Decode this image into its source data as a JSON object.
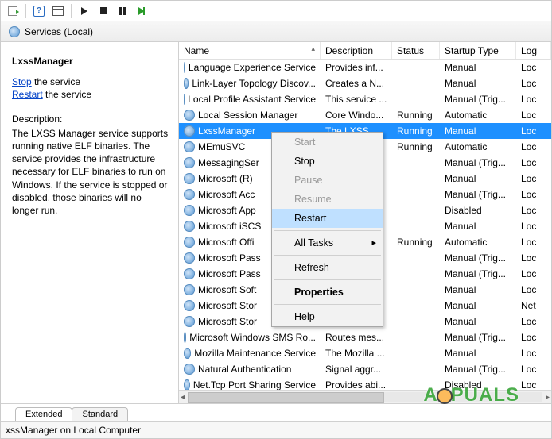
{
  "header": {
    "title": "Services (Local)"
  },
  "details": {
    "title": "LxssManager",
    "stop_label": "Stop",
    "stop_suffix": " the service",
    "restart_label": "Restart",
    "restart_suffix": " the service",
    "description_label": "Description:",
    "description_body": "The LXSS Manager service supports running native ELF binaries. The service provides the infrastructure necessary for ELF binaries to run on Windows. If the service is stopped or disabled, those binaries will no longer run."
  },
  "columns": {
    "name": "Name",
    "description": "Description",
    "status": "Status",
    "startup": "Startup Type",
    "logon": "Log"
  },
  "rows": [
    {
      "name": "Language Experience Service",
      "desc": "Provides inf...",
      "status": "",
      "startup": "Manual",
      "logon": "Loc"
    },
    {
      "name": "Link-Layer Topology Discov...",
      "desc": "Creates a N...",
      "status": "",
      "startup": "Manual",
      "logon": "Loc"
    },
    {
      "name": "Local Profile Assistant Service",
      "desc": "This service ...",
      "status": "",
      "startup": "Manual (Trig...",
      "logon": "Loc"
    },
    {
      "name": "Local Session Manager",
      "desc": "Core Windo...",
      "status": "Running",
      "startup": "Automatic",
      "logon": "Loc"
    },
    {
      "name": "LxssManager",
      "desc": "The LXSS M...",
      "status": "Running",
      "startup": "Manual",
      "logon": "Loc",
      "selected": true
    },
    {
      "name": "MEmuSVC",
      "desc": "",
      "status": "Running",
      "startup": "Automatic",
      "logon": "Loc"
    },
    {
      "name": "MessagingSer",
      "desc": "",
      "status": "",
      "startup": "Manual (Trig...",
      "logon": "Loc"
    },
    {
      "name": "Microsoft (R)",
      "desc": "",
      "status": "",
      "startup": "Manual",
      "logon": "Loc"
    },
    {
      "name": "Microsoft Acc",
      "desc": "",
      "status": "",
      "startup": "Manual (Trig...",
      "logon": "Loc"
    },
    {
      "name": "Microsoft App",
      "desc": "",
      "status": "",
      "startup": "Disabled",
      "logon": "Loc"
    },
    {
      "name": "Microsoft iSCS",
      "desc": "",
      "status": "",
      "startup": "Manual",
      "logon": "Loc"
    },
    {
      "name": "Microsoft Offi",
      "desc": "",
      "status": "Running",
      "startup": "Automatic",
      "logon": "Loc"
    },
    {
      "name": "Microsoft Pass",
      "desc": "",
      "status": "",
      "startup": "Manual (Trig...",
      "logon": "Loc"
    },
    {
      "name": "Microsoft Pass",
      "desc": "",
      "status": "",
      "startup": "Manual (Trig...",
      "logon": "Loc"
    },
    {
      "name": "Microsoft Soft",
      "desc": "",
      "status": "",
      "startup": "Manual",
      "logon": "Loc"
    },
    {
      "name": "Microsoft Stor",
      "desc": "",
      "status": "",
      "startup": "Manual",
      "logon": "Net"
    },
    {
      "name": "Microsoft Stor",
      "desc": "",
      "status": "",
      "startup": "Manual",
      "logon": "Loc"
    },
    {
      "name": "Microsoft Windows SMS Ro...",
      "desc": "Routes mes...",
      "status": "",
      "startup": "Manual (Trig...",
      "logon": "Loc"
    },
    {
      "name": "Mozilla Maintenance Service",
      "desc": "The Mozilla ...",
      "status": "",
      "startup": "Manual",
      "logon": "Loc"
    },
    {
      "name": "Natural Authentication",
      "desc": "Signal aggr...",
      "status": "",
      "startup": "Manual (Trig...",
      "logon": "Loc"
    },
    {
      "name": "Net.Tcp Port Sharing Service",
      "desc": "Provides abi...",
      "status": "",
      "startup": "Disabled",
      "logon": "Loc"
    }
  ],
  "context_menu": {
    "start": "Start",
    "stop": "Stop",
    "pause": "Pause",
    "resume": "Resume",
    "restart": "Restart",
    "all_tasks": "All Tasks",
    "refresh": "Refresh",
    "properties": "Properties",
    "help": "Help"
  },
  "tabs": {
    "extended": "Extended",
    "standard": "Standard"
  },
  "status_bar": "xssManager on Local Computer",
  "watermark": "A  PUALS"
}
